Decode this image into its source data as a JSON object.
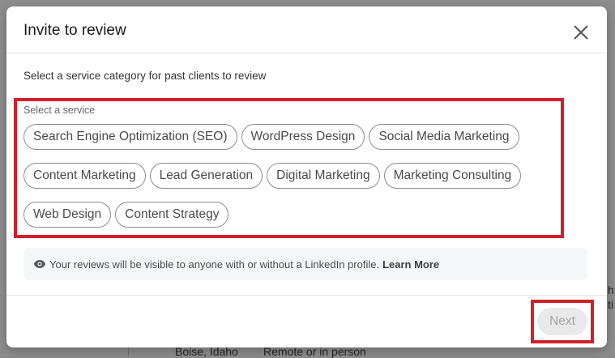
{
  "background": {
    "location": "Boise, Idaho",
    "work_mode": "Remote or in person",
    "edge_text_1": "h",
    "edge_text_2": "ti"
  },
  "modal": {
    "title": "Invite to review",
    "close_icon": "close-icon",
    "instruction": "Select a service category for past clients to review",
    "select_label": "Select a service",
    "services": [
      [
        "Search Engine Optimization (SEO)",
        "WordPress Design",
        "Social Media Marketing"
      ],
      [
        "Content Marketing",
        "Lead Generation",
        "Digital Marketing",
        "Marketing Consulting"
      ],
      [
        "Web Design",
        "Content Strategy"
      ]
    ],
    "notice": {
      "icon": "eye-icon",
      "text": "Your reviews will be visible to anyone with or without a LinkedIn profile.",
      "link": "Learn More"
    },
    "next_label": "Next"
  },
  "colors": {
    "highlight": "#d0202a",
    "disabled_button_bg": "#e9e9e9",
    "disabled_button_text": "#a3a3a3"
  }
}
